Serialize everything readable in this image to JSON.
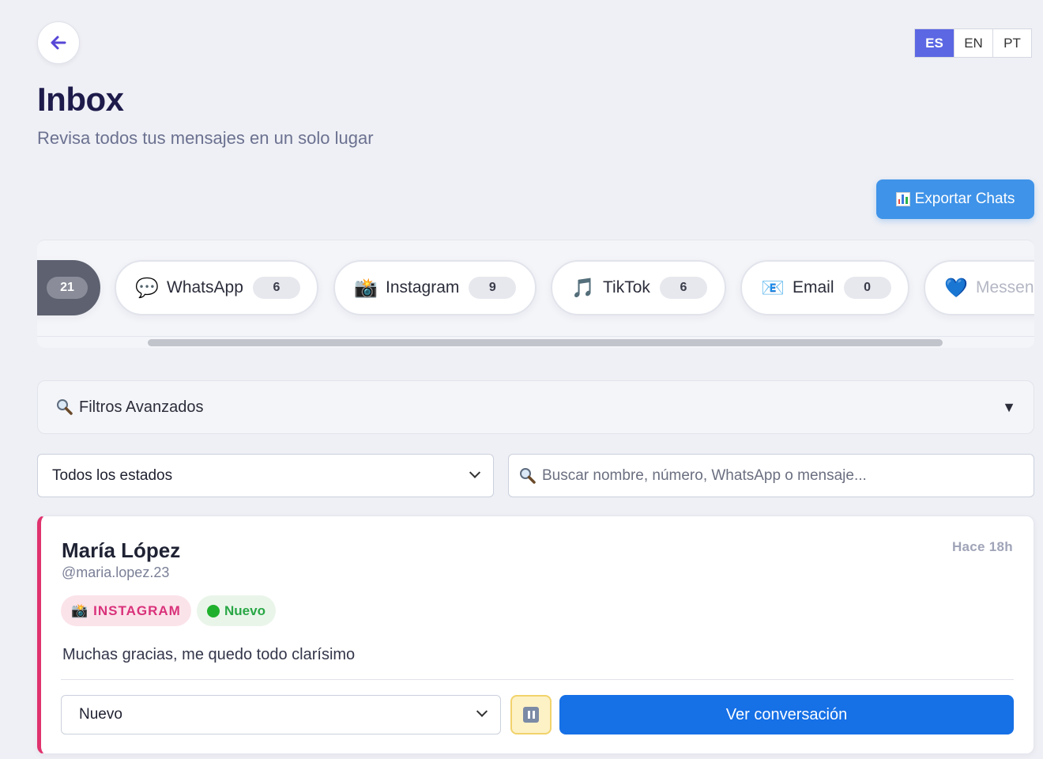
{
  "header": {
    "title": "Inbox",
    "subtitle": "Revisa todos tus mensajes en un solo lugar",
    "back_icon": "arrow-left-icon"
  },
  "language": {
    "options": [
      "ES",
      "EN",
      "PT"
    ],
    "selected": "ES",
    "accent_color": "#5b67e3"
  },
  "export_button": {
    "label": "Exportar Chats",
    "icon": "bar-chart-icon",
    "color": "#3f93e8"
  },
  "channels": {
    "all_count": "21",
    "items": [
      {
        "label": "WhatsApp",
        "count": "6",
        "icon": "speech-bubble-icon",
        "glyph": "💬"
      },
      {
        "label": "Instagram",
        "count": "9",
        "icon": "camera-flash-icon",
        "glyph": "📸"
      },
      {
        "label": "TikTok",
        "count": "6",
        "icon": "music-note-icon",
        "glyph": "🎵"
      },
      {
        "label": "Email",
        "count": "0",
        "icon": "envelope-icon",
        "glyph": "📧"
      },
      {
        "label": "Messen",
        "icon": "blue-heart-icon",
        "glyph": "💙"
      }
    ]
  },
  "filters": {
    "label": "Filtros Avanzados",
    "status_select": "Todos los estados",
    "search_placeholder": "Buscar nombre, número, WhatsApp o mensaje..."
  },
  "conversation": {
    "name": "María López",
    "handle": "@maria.lopez.23",
    "time_ago": "Hace 18h",
    "platform_tag": "INSTAGRAM",
    "status_tag": "Nuevo",
    "message": "Muchas gracias, me quedo todo clarísimo",
    "status_select": "Nuevo",
    "view_button": "Ver conversación",
    "accent_color": "#e0336e"
  }
}
